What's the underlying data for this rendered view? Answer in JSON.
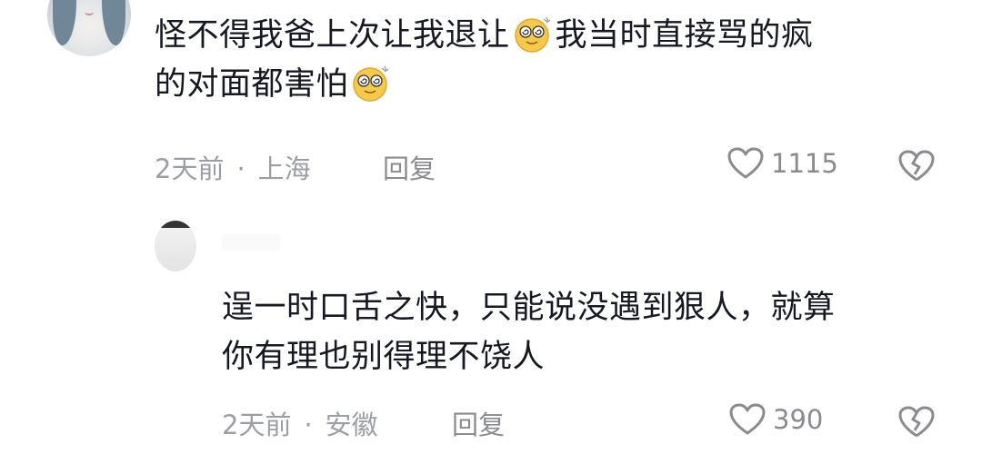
{
  "comments": [
    {
      "lines": [
        [
          "怪不得我爸上次让我退让",
          "[emoji]",
          "我当时直接骂的疯"
        ],
        [
          "的对面都害怕",
          "[emoji]"
        ]
      ],
      "line1_a": "怪不得我爸上次让我退让",
      "line1_b": "我当时直接骂的疯",
      "line2_a": "的对面都害怕",
      "time": "2天前",
      "location": "上海",
      "reply_label": "回复",
      "likes": "1115",
      "emoji_icon": "dizzy-face-emoji"
    },
    {
      "line1": "逞一时口舌之快，只能说没遇到狠人，就算",
      "line2": "你有理也别得理不饶人",
      "time": "2天前",
      "location": "安徽",
      "reply_label": "回复",
      "likes": "390"
    }
  ],
  "separator": "·",
  "icons": {
    "like": "heart-outline-icon",
    "dislike": "broken-heart-icon"
  },
  "colors": {
    "text": "#161823",
    "meta": "#9c9ea6",
    "icon": "#8a8b91",
    "emoji": "#f7c948"
  }
}
